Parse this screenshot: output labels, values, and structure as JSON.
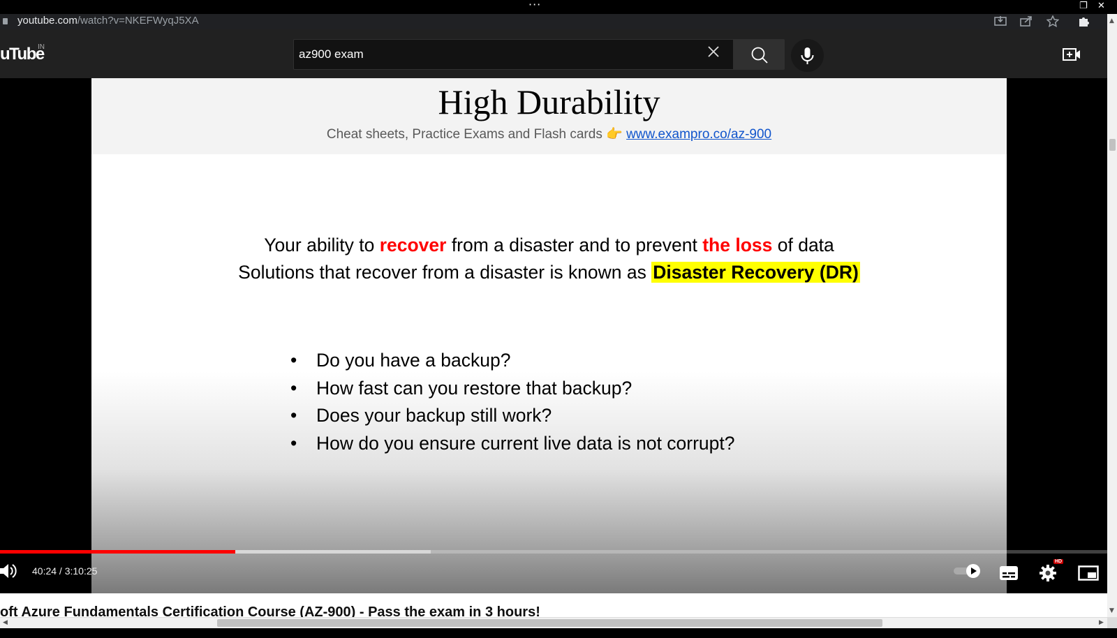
{
  "window": {
    "more_glyph": "···",
    "restore_glyph": "❐",
    "close_glyph": "✕"
  },
  "address_bar": {
    "host": "youtube.com",
    "path": "/watch?v=NKEFWyqJ5XA",
    "icons": [
      "install-icon",
      "share-icon",
      "star-icon",
      "extensions-icon"
    ]
  },
  "masthead": {
    "logo": "uTube",
    "country": "IN",
    "search_value": "az900 exam",
    "search_placeholder": "Search"
  },
  "slide": {
    "title": "High Durability",
    "subtitle_text": "Cheat sheets, Practice Exams and Flash cards",
    "subtitle_hand": "👉",
    "subtitle_link": "www.exampro.co/az-900",
    "line1": {
      "a": "Your ability to ",
      "b": "recover",
      "c": " from a disaster and to prevent ",
      "d": "the loss",
      "e": " of data"
    },
    "line2": {
      "a": "Solutions that recover from a disaster is known as ",
      "b": "Disaster Recovery (DR)"
    },
    "bullet_glyph": "•",
    "bullets": [
      "Do you have a backup?",
      "How fast can you restore that backup?",
      "Does your backup still work?",
      "How do you ensure current live data is not corrupt?"
    ]
  },
  "player": {
    "current_time": "40:24",
    "separator": " / ",
    "duration": "3:10:25",
    "played_fraction": 0.2126,
    "buffered_fraction": 0.1767,
    "quality_badge": "HD",
    "accent": "#ff0000"
  },
  "video_title": "oft Azure Fundamentals Certification Course (AZ-900) - Pass the exam in 3 hours!",
  "scrollbars": {
    "up": "▲",
    "down": "▼",
    "left": "◀",
    "right": "▶"
  }
}
